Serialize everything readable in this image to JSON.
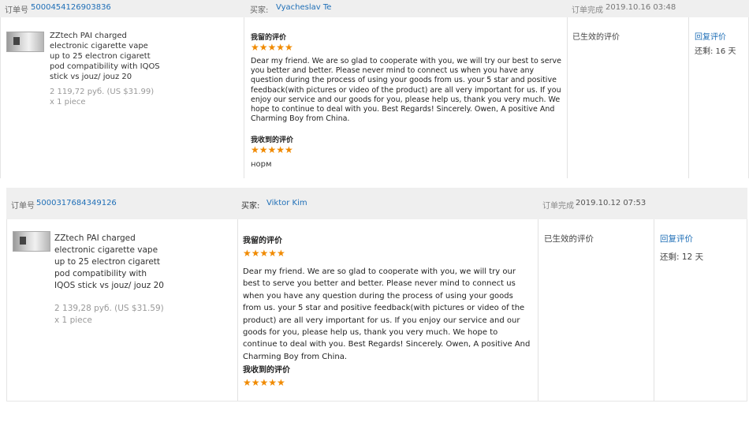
{
  "orders": [
    {
      "order_label": "订单号",
      "order_no": "5000454126903836",
      "buyer_label": "买家:",
      "buyer": "Vyacheslav Te",
      "completed_label": "订单完成",
      "completed_time": "2019.10.16 03:48",
      "product_name": "ZZtech PAI charged electronic cigarette vape up to 25 electron cigarett pod compatibility with IQOS stick vs jouz/ jouz 20",
      "price": "2 119,72 руб. (US $31.99)",
      "quantity": "x 1 piece",
      "my_review_label": "我留的评价",
      "my_stars": "★★★★★",
      "review_text": "Dear my friend. We are so glad to cooperate with you, we will try our best to serve you better and better. Please never mind to connect us when you have any question during the process of using your goods from us. your 5 star and positive feedback(with pictures or video of the product) are all very important for us. If you enjoy our service and our goods for you, please help us, thank you very much. We hope to continue to deal with you. Best Regards! Sincerely. Owen, A positive And Charming Boy from China.",
      "received_label": "我收到的评价",
      "received_stars": "★★★★★",
      "received_text": "норм",
      "status": "已生效的评价",
      "reply_link": "回复评价",
      "remaining": "还剩:  16 天"
    },
    {
      "order_label": "订单号",
      "order_no": "5000317684349126",
      "buyer_label": "买家:",
      "buyer": "Viktor Kim",
      "completed_label": "订单完成",
      "completed_time": "2019.10.12 07:53",
      "product_name": "ZZtech PAI charged electronic cigarette vape up to 25 electron cigarett pod compatibility with IQOS stick vs jouz/ jouz 20",
      "price": "2 139,28 руб. (US $31.59)",
      "quantity": "x 1 piece",
      "my_review_label": "我留的评价",
      "my_stars": "★★★★★",
      "review_text": "Dear my friend. We are so glad to cooperate with you, we will try our best to serve you better and better. Please never mind to connect us when you have any question during the process of using your goods from us. your 5 star and positive feedback(with pictures or video of the product) are all very important for us. If you enjoy our service and our goods for you, please help us, thank you very much. We hope to continue to deal with you. Best Regards! Sincerely. Owen, A positive And Charming Boy from China.",
      "received_label": "我收到的评价",
      "received_stars": "★★★★★",
      "status": "已生效的评价",
      "reply_link": "回复评价",
      "remaining": "还剩:  12 天"
    }
  ],
  "colors": {
    "link": "#1f6fb7",
    "star": "#f08a00",
    "header_bg": "#efefef"
  },
  "icons": {
    "product_thumbnail": "vape-device-image"
  }
}
